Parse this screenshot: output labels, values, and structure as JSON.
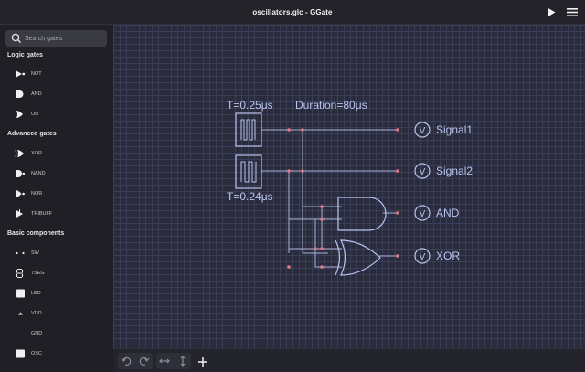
{
  "window": {
    "title": "oscillators.glc - GGate"
  },
  "search": {
    "placeholder": "Search gates"
  },
  "sections": {
    "logic": "Logic gates",
    "advanced": "Advanced gates",
    "basic": "Basic components"
  },
  "items": {
    "not": "NOT",
    "and": "AND",
    "or": "OR",
    "xor": "XOR",
    "nand": "NAND",
    "nor": "NOR",
    "tribuff": "TRIBUFF",
    "sw": "SW",
    "seg7": "7SEG",
    "led": "LED",
    "vdd": "VDD",
    "gnd": "GND",
    "osc": "OSC"
  },
  "circuit": {
    "osc1_label": "T=0.25μs",
    "osc2_label": "T=0.24μs",
    "duration": "Duration=80μs",
    "meter_symbol": "V",
    "probe1": "Signal1",
    "probe2": "Signal2",
    "probe3": "AND",
    "probe4": "XOR"
  },
  "colors": {
    "wire": "#a9b4d8",
    "component": "#b8c3ee",
    "junction": "#e07a8a",
    "canvas": "#2a2c3d"
  }
}
